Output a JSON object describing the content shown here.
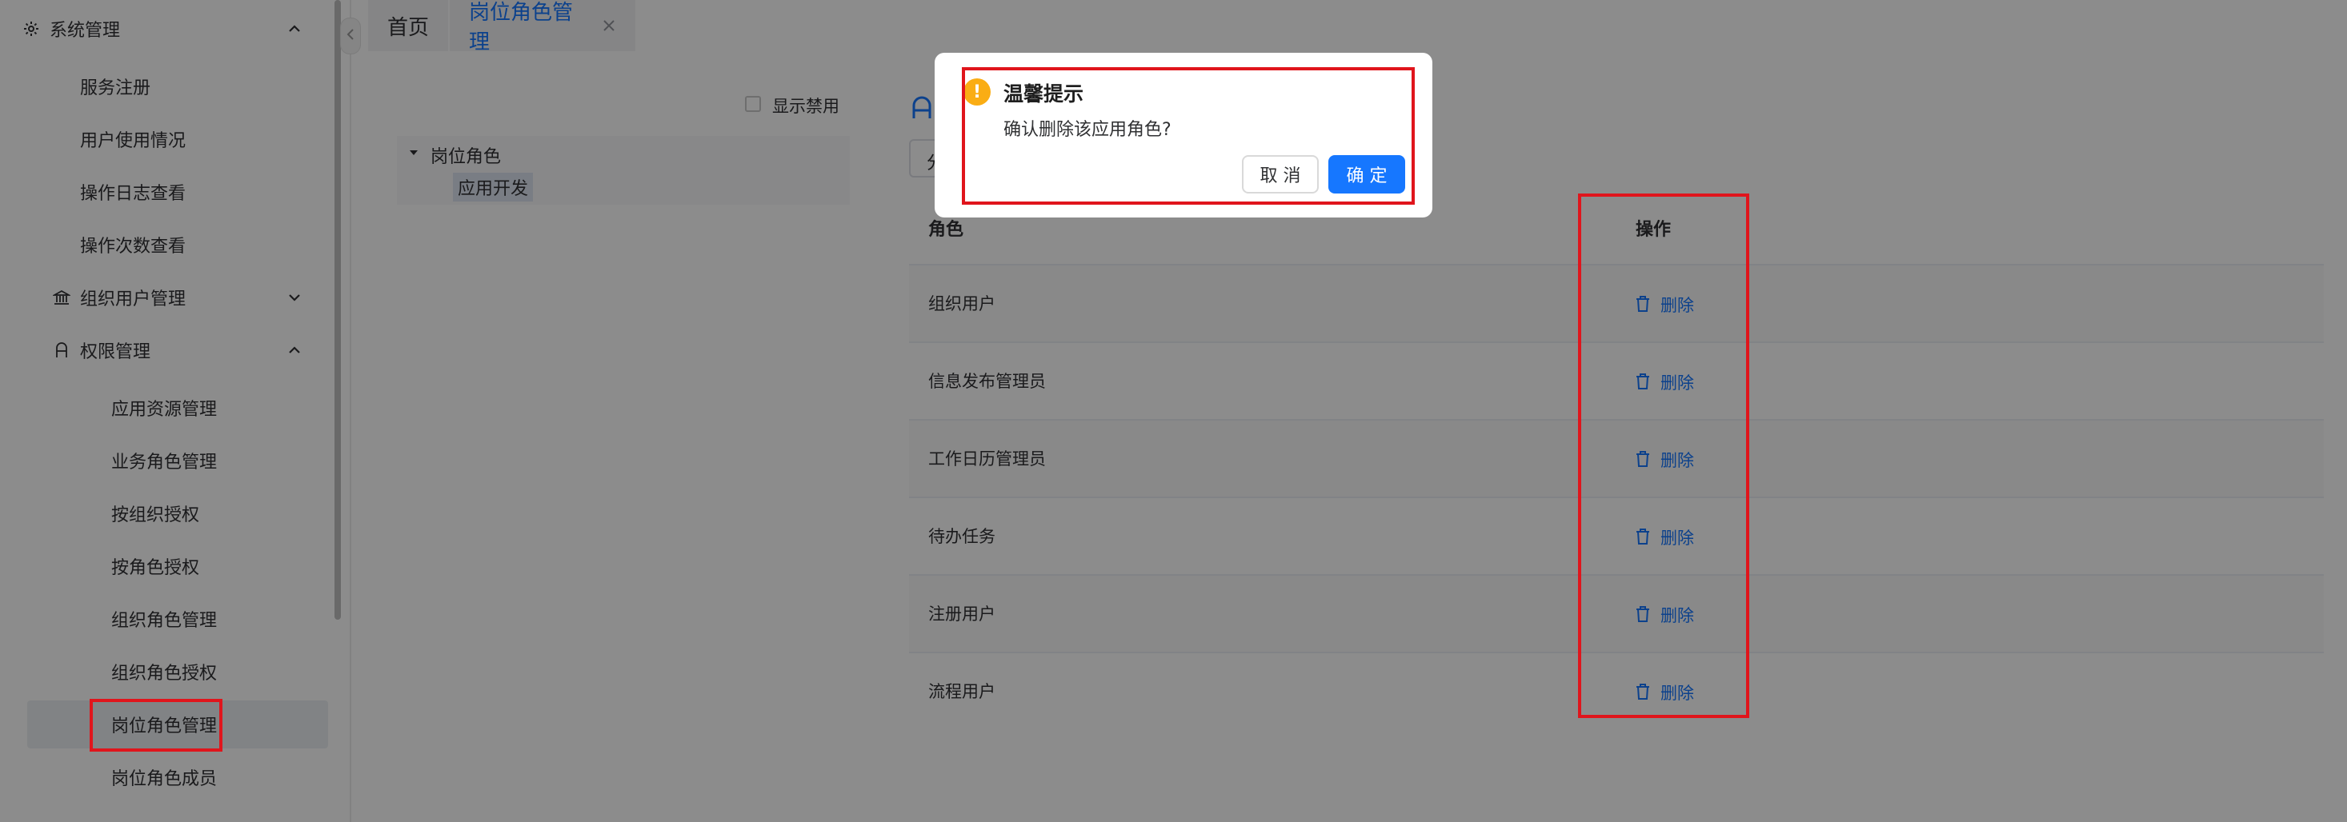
{
  "sidebar": {
    "items": [
      {
        "label": "系统管理",
        "icon": "gear-icon"
      },
      {
        "label": "服务注册"
      },
      {
        "label": "用户使用情况"
      },
      {
        "label": "操作日志查看"
      },
      {
        "label": "操作次数查看"
      },
      {
        "label": "组织用户管理",
        "icon": "bank-icon"
      },
      {
        "label": "权限管理",
        "icon": "user-lock-icon"
      },
      {
        "label": "应用资源管理"
      },
      {
        "label": "业务角色管理"
      },
      {
        "label": "按组织授权"
      },
      {
        "label": "按角色授权"
      },
      {
        "label": "组织角色管理"
      },
      {
        "label": "组织角色授权"
      },
      {
        "label": "岗位角色管理"
      },
      {
        "label": "岗位角色成员"
      }
    ]
  },
  "tabs": [
    {
      "label": "首页"
    },
    {
      "label": "岗位角色管理"
    }
  ],
  "tree_pane": {
    "show_disabled_label": "显示禁用",
    "root": "岗位角色",
    "child": "应用开发"
  },
  "table": {
    "headers": {
      "role": "角色",
      "action": "操作"
    },
    "delete_label": "删除",
    "rows": [
      {
        "role": "组织用户"
      },
      {
        "role": "信息发布管理员"
      },
      {
        "role": "工作日历管理员"
      },
      {
        "role": "待办任务"
      },
      {
        "role": "注册用户"
      },
      {
        "role": "流程用户"
      }
    ]
  },
  "partial_input_text": "分",
  "dialog": {
    "title": "温馨提示",
    "message": "确认删除该应用角色?",
    "cancel_label": "取 消",
    "ok_label": "确 定",
    "warning_glyph": "!"
  },
  "colors": {
    "primary": "#1677ff",
    "warning": "#faad14",
    "highlight": "#e0151c"
  }
}
